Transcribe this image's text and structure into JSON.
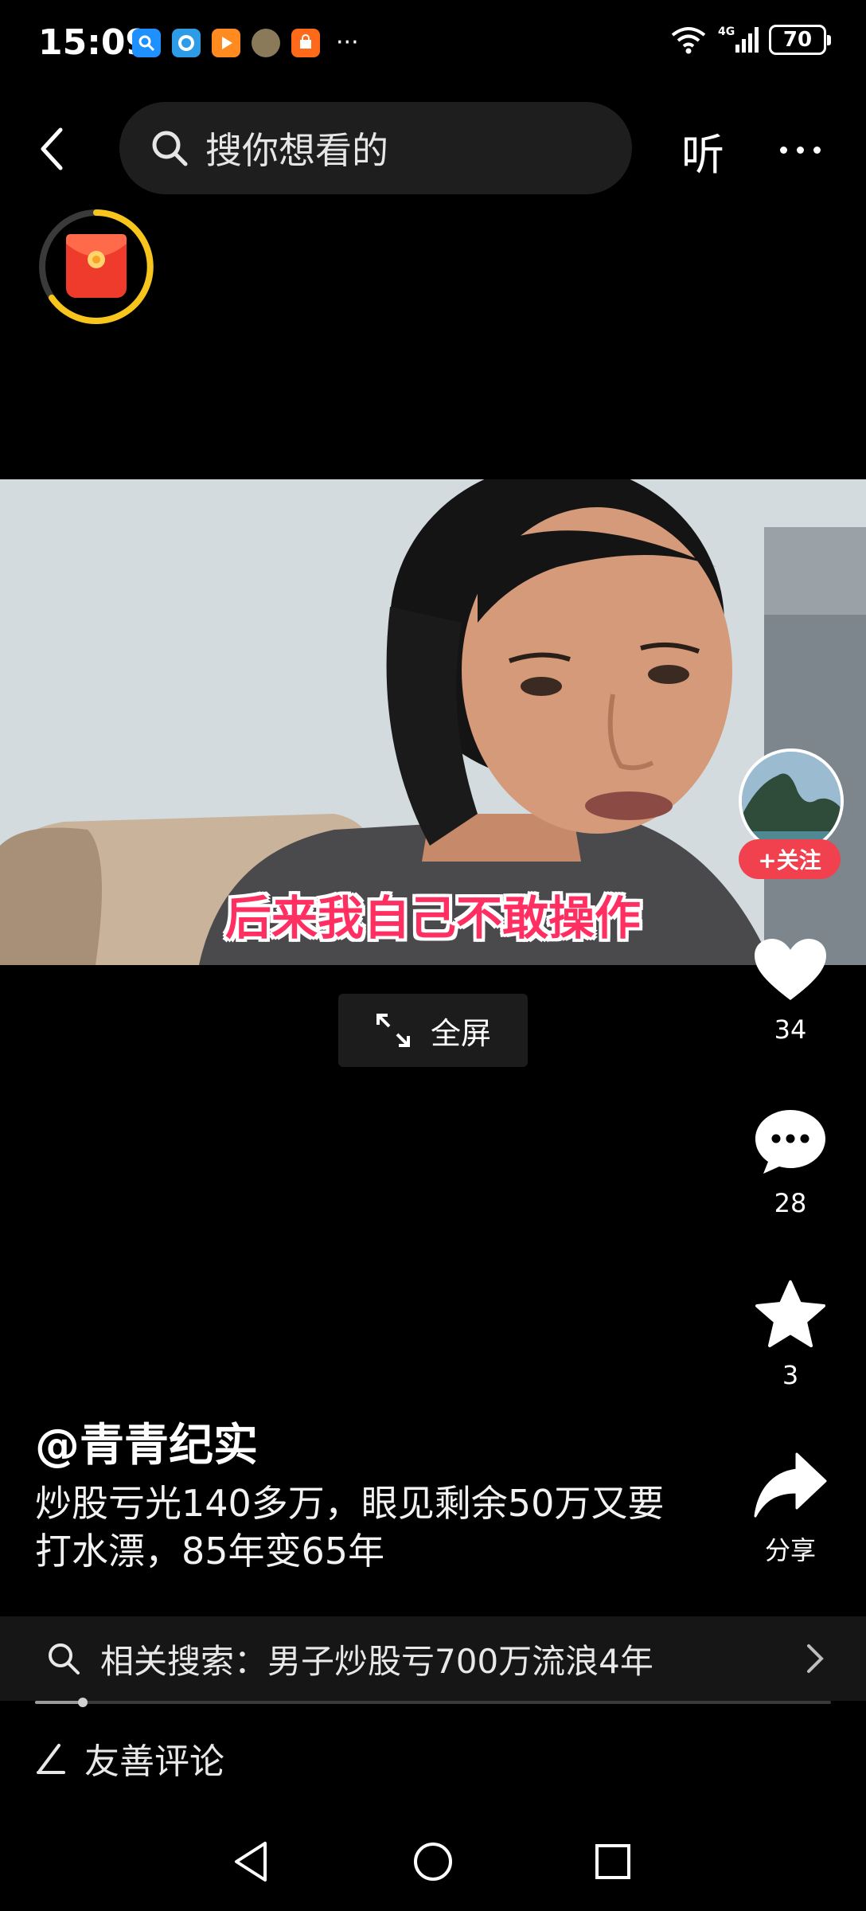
{
  "status_bar": {
    "time": "15:09",
    "battery": "70",
    "notif_more": "···",
    "notif_icons": [
      "search-app-icon",
      "browser-app-icon",
      "video-app-icon",
      "avatar-app-icon",
      "shop-app-icon"
    ],
    "signal_icons": [
      "wifi-icon",
      "cellular-4g-icon"
    ]
  },
  "top_nav": {
    "search_placeholder": "搜你想看的",
    "listen_label": "听"
  },
  "video": {
    "subtitle": "后来我自己不敢操作",
    "fullscreen_label": "全屏"
  },
  "actions": {
    "follow_label": "+关注",
    "likes": "34",
    "comments": "28",
    "favorites": "3",
    "share_label": "分享"
  },
  "post": {
    "author": "@青青纪实",
    "description": "炒股亏光140多万，眼见剩余50万又要打水漂，85年变65年"
  },
  "related_search": {
    "text": "相关搜索：男子炒股亏700万流浪4年"
  },
  "playback": {
    "progress": 0.06
  },
  "comment_bar": {
    "placeholder": "友善评论"
  },
  "colors": {
    "accent_red": "#f1414f",
    "subtitle_red": "#ff2f62",
    "ring_yellow": "#f7c51b"
  }
}
